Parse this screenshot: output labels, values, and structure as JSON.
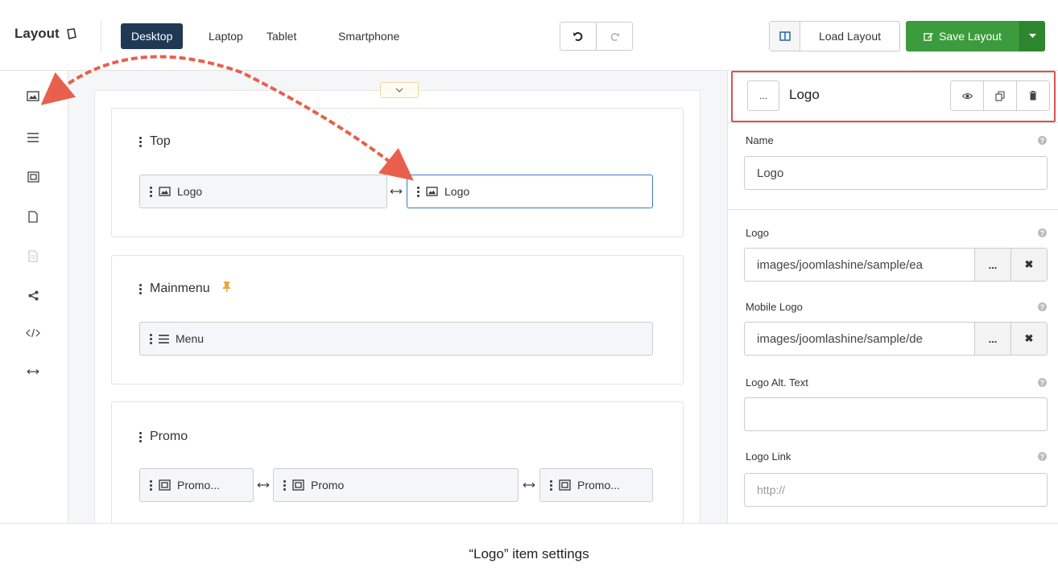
{
  "header": {
    "title": "Layout",
    "devices": [
      "Desktop",
      "Laptop",
      "Tablet",
      "Smartphone"
    ],
    "active_device": "Desktop",
    "load_label": "Load Layout",
    "save_label": "Save Layout"
  },
  "tools": [
    "image-icon",
    "menu-icon",
    "promo-icon",
    "page-icon",
    "document-icon",
    "share-icon",
    "code-icon",
    "width-icon"
  ],
  "rows": {
    "top": {
      "title": "Top",
      "blocks": [
        "Logo",
        "Logo"
      ]
    },
    "mainmenu": {
      "title": "Mainmenu",
      "blocks": [
        "Menu"
      ]
    },
    "promo": {
      "title": "Promo",
      "blocks": [
        "Promo...",
        "Promo",
        "Promo..."
      ]
    }
  },
  "panel": {
    "title": "Logo",
    "dots": "...",
    "fields": {
      "name_label": "Name",
      "name_value": "Logo",
      "logo_label": "Logo",
      "logo_value": "images/joomlashine/sample/ea",
      "mobile_label": "Mobile Logo",
      "mobile_value": "images/joomlashine/sample/de",
      "alt_label": "Logo Alt. Text",
      "alt_value": "",
      "link_label": "Logo Link",
      "link_placeholder": "http://",
      "browse": "...",
      "clear": "✖",
      "help": "?"
    }
  },
  "caption": "“Logo” item settings",
  "colors": {
    "accent": "#1f3955",
    "save": "#3c9b3c",
    "highlight": "#d9534f",
    "arrow": "#e8604c"
  }
}
